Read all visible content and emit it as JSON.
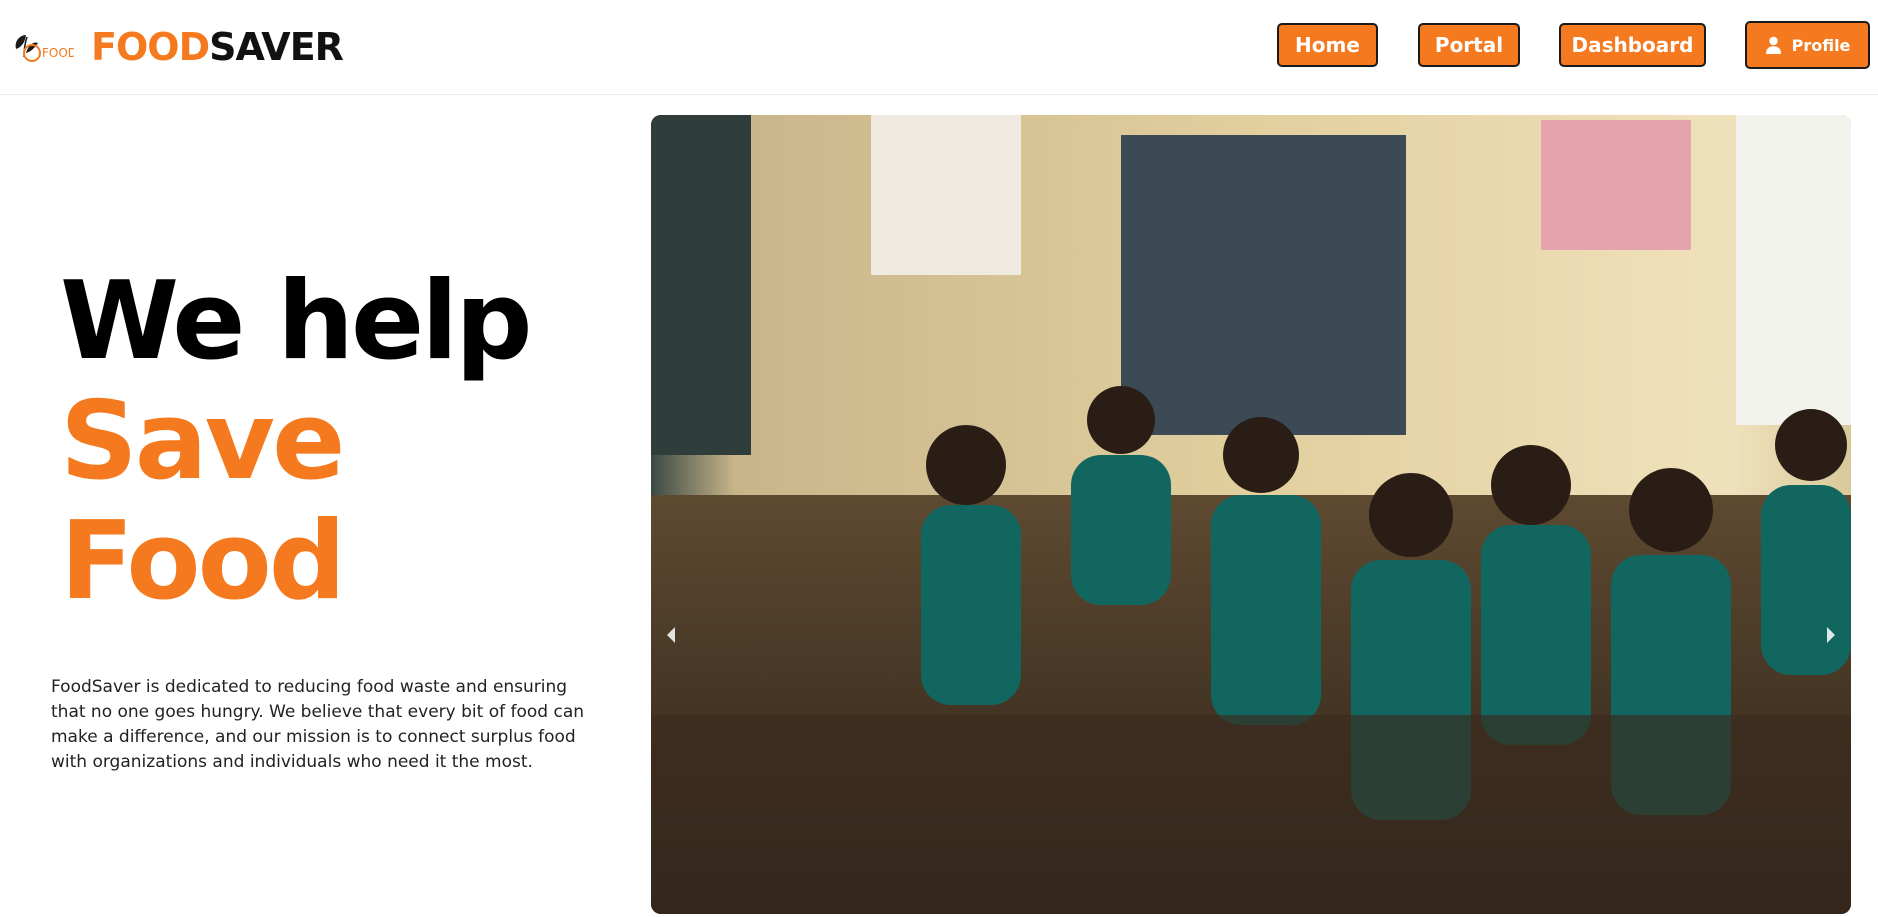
{
  "brand": {
    "part1": "FOOD",
    "part2": "SAVER",
    "logo_text": "FOOD"
  },
  "nav": {
    "home": "Home",
    "portal": "Portal",
    "dashboard": "Dashboard",
    "profile": "Profile"
  },
  "hero": {
    "line1": "We help",
    "line2": "Save",
    "line3": "Food",
    "description": "FoodSaver is dedicated to reducing food waste and ensuring that no one goes hungry. We believe that every bit of food can make a difference, and our mission is to connect surplus food with organizations and individuals who need it the most."
  },
  "colors": {
    "accent": "#f57a1f",
    "dark": "#111111"
  },
  "icons": {
    "profile": "user-icon",
    "prev": "chevron-left-icon",
    "next": "chevron-right-icon"
  }
}
